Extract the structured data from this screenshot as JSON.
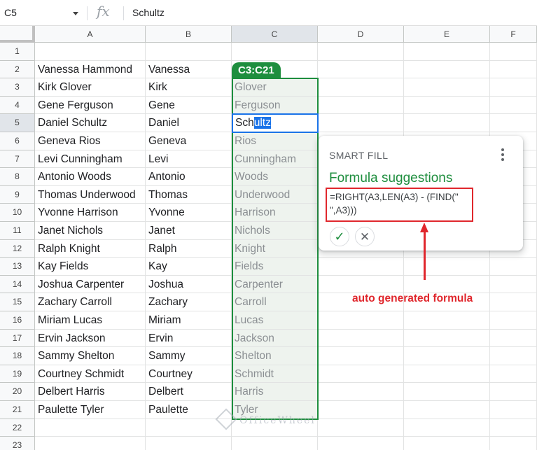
{
  "formula_bar": {
    "name_box": "C5",
    "fx_label": "fx",
    "content": "Schultz"
  },
  "columns": [
    "A",
    "B",
    "C",
    "D",
    "E",
    "F"
  ],
  "rows": [
    "1",
    "2",
    "3",
    "4",
    "5",
    "6",
    "7",
    "8",
    "9",
    "10",
    "11",
    "12",
    "13",
    "14",
    "15",
    "16",
    "17",
    "18",
    "19",
    "20",
    "21",
    "22",
    "23"
  ],
  "sheet": [
    {
      "a": "",
      "b": "",
      "c": ""
    },
    {
      "a": "Vanessa Hammond",
      "b": "Vanessa",
      "c": ""
    },
    {
      "a": "Kirk Glover",
      "b": "Kirk",
      "c": "Glover"
    },
    {
      "a": "Gene Ferguson",
      "b": "Gene",
      "c": "Ferguson"
    },
    {
      "a": "Daniel Schultz",
      "b": "Daniel",
      "c": ""
    },
    {
      "a": "Geneva Rios",
      "b": "Geneva",
      "c": "Rios"
    },
    {
      "a": "Levi Cunningham",
      "b": "Levi",
      "c": "Cunningham"
    },
    {
      "a": "Antonio Woods",
      "b": "Antonio",
      "c": "Woods"
    },
    {
      "a": "Thomas Underwood",
      "b": "Thomas",
      "c": "Underwood"
    },
    {
      "a": "Yvonne Harrison",
      "b": "Yvonne",
      "c": "Harrison"
    },
    {
      "a": "Janet Nichols",
      "b": "Janet",
      "c": "Nichols"
    },
    {
      "a": "Ralph Knight",
      "b": "Ralph",
      "c": "Knight"
    },
    {
      "a": "Kay Fields",
      "b": "Kay",
      "c": "Fields"
    },
    {
      "a": "Joshua Carpenter",
      "b": "Joshua",
      "c": "Carpenter"
    },
    {
      "a": "Zachary Carroll",
      "b": "Zachary",
      "c": "Carroll"
    },
    {
      "a": "Miriam Lucas",
      "b": "Miriam",
      "c": "Lucas"
    },
    {
      "a": "Ervin Jackson",
      "b": "Ervin",
      "c": "Jackson"
    },
    {
      "a": "Sammy Shelton",
      "b": "Sammy",
      "c": "Shelton"
    },
    {
      "a": "Courtney Schmidt",
      "b": "Courtney",
      "c": "Schmidt"
    },
    {
      "a": "Delbert Harris",
      "b": "Delbert",
      "c": "Harris"
    },
    {
      "a": "Paulette Tyler",
      "b": "Paulette",
      "c": "Tyler"
    },
    {
      "a": "",
      "b": "",
      "c": ""
    },
    {
      "a": "",
      "b": "",
      "c": ""
    }
  ],
  "selection": {
    "range_label": "C3:C21",
    "active_cell_typed": "Sch",
    "active_cell_highlighted": "ultz"
  },
  "smart_fill": {
    "title": "SMART FILL",
    "menu_icon": "more-vert-icon",
    "subtitle": "Formula suggestions",
    "formula_line1": "=RIGHT(A3,LEN(A3) - (FIND(\"",
    "formula_line2": "\",A3)))",
    "accept_icon": "check-icon",
    "reject_icon": "close-icon"
  },
  "annotation": {
    "text": "auto generated formula"
  },
  "watermark": {
    "text": "OfficeWheel"
  },
  "colors": {
    "accent_green": "#1e8e3e",
    "active_blue": "#1a73e8",
    "annotation_red": "#e0272d"
  }
}
